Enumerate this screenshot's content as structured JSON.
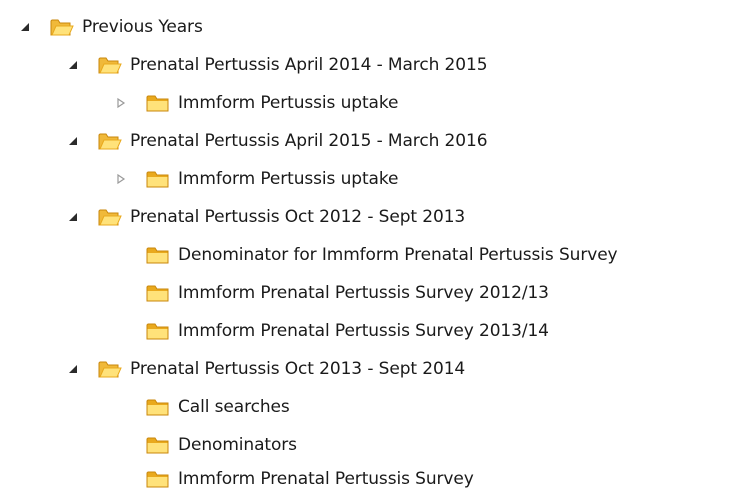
{
  "tree": {
    "root": {
      "label": "Previous Years",
      "icon": "folder-open-icon",
      "children": [
        {
          "label": "Prenatal Pertussis April 2014 - March 2015",
          "children": [
            {
              "label": "Immform Pertussis uptake"
            }
          ]
        },
        {
          "label": "Prenatal Pertussis April 2015 - March 2016",
          "children": [
            {
              "label": "Immform Pertussis uptake"
            }
          ]
        },
        {
          "label": "Prenatal Pertussis Oct 2012 - Sept 2013",
          "children": [
            {
              "label": "Denominator for Immform Prenatal Pertussis Survey"
            },
            {
              "label": "Immform Prenatal Pertussis Survey 2012/13"
            },
            {
              "label": "Immform Prenatal Pertussis Survey 2013/14"
            }
          ]
        },
        {
          "label": "Prenatal Pertussis Oct 2013 - Sept 2014",
          "children": [
            {
              "label": "Call searches"
            },
            {
              "label": "Denominators"
            },
            {
              "label": "Immform Prenatal Pertussis Survey"
            }
          ]
        }
      ]
    }
  },
  "colors": {
    "folder_light": "#ffe27a",
    "folder_dark": "#e9a91d",
    "folder_edge": "#c9870b",
    "expander": "#2b2b2b",
    "collapsed_expander": "#9a9a9a"
  }
}
